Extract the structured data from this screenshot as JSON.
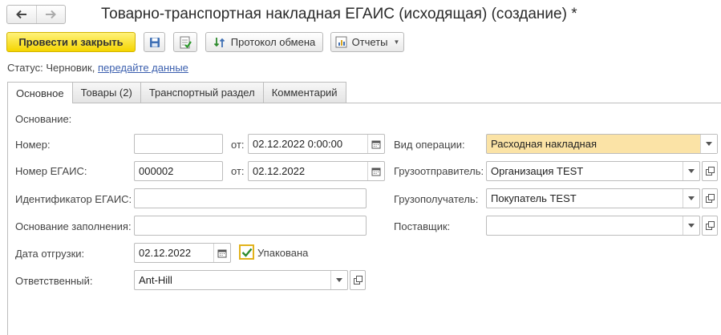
{
  "header": {
    "title": "Товарно-транспортная накладная ЕГАИС (исходящая) (создание) *",
    "back_icon": "arrow-left-icon",
    "forward_icon": "arrow-right-icon"
  },
  "toolbar": {
    "post_close_label": "Провести и закрыть",
    "save_icon": "floppy-disk-icon",
    "post_icon": "post-document-icon",
    "exchange_log_label": "Протокол обмена",
    "reports_label": "Отчеты"
  },
  "status": {
    "label": "Статус:",
    "value": "Черновик,",
    "link": "передайте данные"
  },
  "tabs": [
    {
      "label": "Основное",
      "active": true
    },
    {
      "label": "Товары (2)",
      "active": false
    },
    {
      "label": "Транспортный раздел",
      "active": false
    },
    {
      "label": "Комментарий",
      "active": false
    }
  ],
  "form": {
    "basis_label": "Основание:",
    "number_label": "Номер:",
    "number_value": "",
    "from_label": "от:",
    "number_date": "02.12.2022  0:00:00",
    "egais_number_label": "Номер ЕГАИС:",
    "egais_number_value": "000002",
    "egais_date": "02.12.2022",
    "egais_id_label": "Идентификатор ЕГАИС:",
    "egais_id_value": "",
    "fill_basis_label": "Основание заполнения:",
    "fill_basis_value": "",
    "ship_date_label": "Дата отгрузки:",
    "ship_date_value": "02.12.2022",
    "packed_label": "Упакована",
    "packed_checked": true,
    "responsible_label": "Ответственный:",
    "responsible_value": "Ant-Hill",
    "operation_label": "Вид операции:",
    "operation_value": "Расходная накладная",
    "shipper_label": "Грузоотправитель:",
    "shipper_value": "Организация TEST",
    "consignee_label": "Грузополучатель:",
    "consignee_value": "Покупатель TEST",
    "supplier_label": "Поставщик:",
    "supplier_value": ""
  },
  "colors": {
    "primary_button": "#f5d500",
    "link": "#3b5fae",
    "operation_field": "#fbe3a6",
    "checkbox_border": "#e2b21b",
    "checkmark": "#2e8b2e"
  }
}
